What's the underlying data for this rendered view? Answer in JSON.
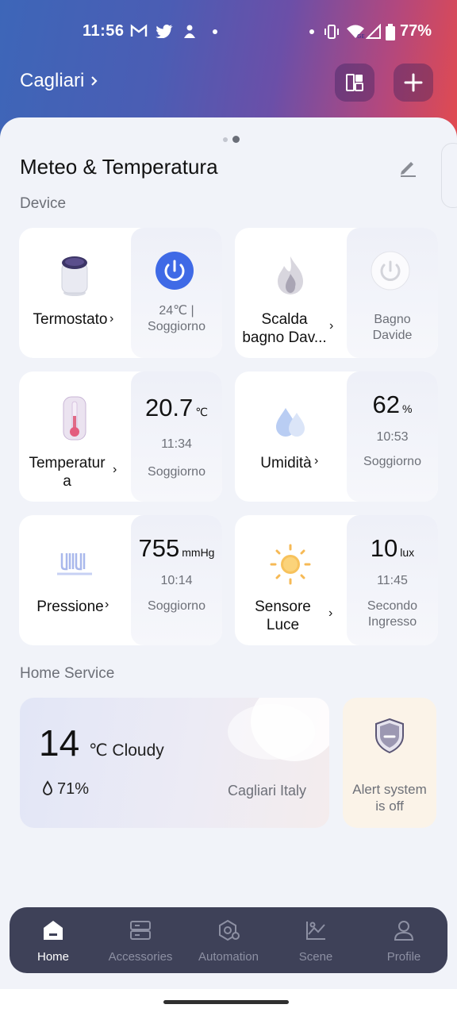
{
  "status_bar": {
    "time": "11:56",
    "battery": "77%"
  },
  "header": {
    "location": "Cagliari"
  },
  "page": {
    "title": "Meteo & Temperatura"
  },
  "sections": {
    "device": "Device",
    "home_service": "Home Service"
  },
  "devices": [
    {
      "name": "Termostato",
      "status_line1": "24℃ |",
      "status_line2": "Soggiorno"
    },
    {
      "name_line1": "Scalda",
      "name_line2": "bagno Dav...",
      "status_line1": "Bagno",
      "status_line2": "Davide"
    },
    {
      "name_line1": "Temperatur",
      "name_line2": "a",
      "value": "20.7",
      "unit": "℃",
      "time": "11:34",
      "room": "Soggiorno"
    },
    {
      "name": "Umidità",
      "value": "62",
      "unit": "%",
      "time": "10:53",
      "room": "Soggiorno"
    },
    {
      "name": "Pressione",
      "value": "755",
      "unit": "mmHg",
      "time": "10:14",
      "room": "Soggiorno"
    },
    {
      "name_line1": "Sensore",
      "name_line2": "Luce",
      "value": "10",
      "unit": "lux",
      "time": "11:45",
      "room_line1": "Secondo",
      "room_line2": "Ingresso"
    }
  ],
  "weather": {
    "temp": "14",
    "condition": "℃ Cloudy",
    "humidity": "71%",
    "location": "Cagliari Italy"
  },
  "alert": {
    "line1": "Alert system",
    "line2": "is off"
  },
  "nav": [
    {
      "label": "Home",
      "icon": "home-icon",
      "active": true
    },
    {
      "label": "Accessories",
      "icon": "accessories-icon"
    },
    {
      "label": "Automation",
      "icon": "automation-icon"
    },
    {
      "label": "Scene",
      "icon": "scene-icon"
    },
    {
      "label": "Profile",
      "icon": "profile-icon"
    }
  ],
  "colors": {
    "accent": "#3f6ae6",
    "nav_bg": "#3e4158"
  }
}
